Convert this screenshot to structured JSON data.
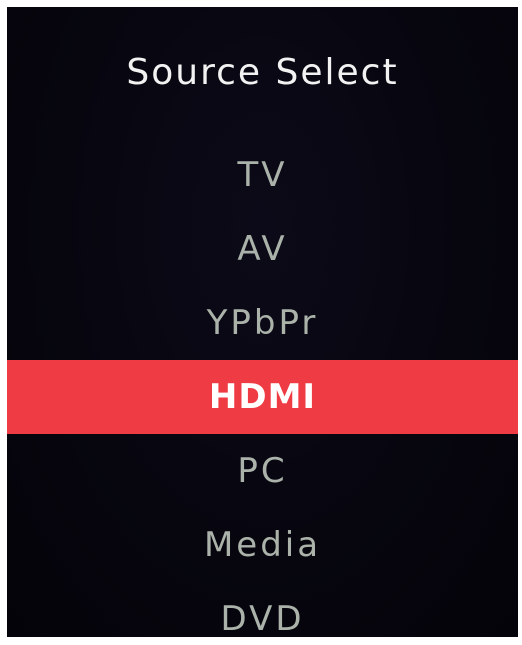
{
  "title": "Source Select",
  "selected_index": 3,
  "colors": {
    "background": "#07060f",
    "highlight": "#ef3b43",
    "item_text": "#aab2aa",
    "selected_text": "#ffffff",
    "title_text": "#f2f2f2"
  },
  "items": [
    {
      "label": "TV"
    },
    {
      "label": "AV"
    },
    {
      "label": "YPbPr"
    },
    {
      "label": "HDMI"
    },
    {
      "label": "PC"
    },
    {
      "label": "Media"
    },
    {
      "label": "DVD"
    }
  ]
}
